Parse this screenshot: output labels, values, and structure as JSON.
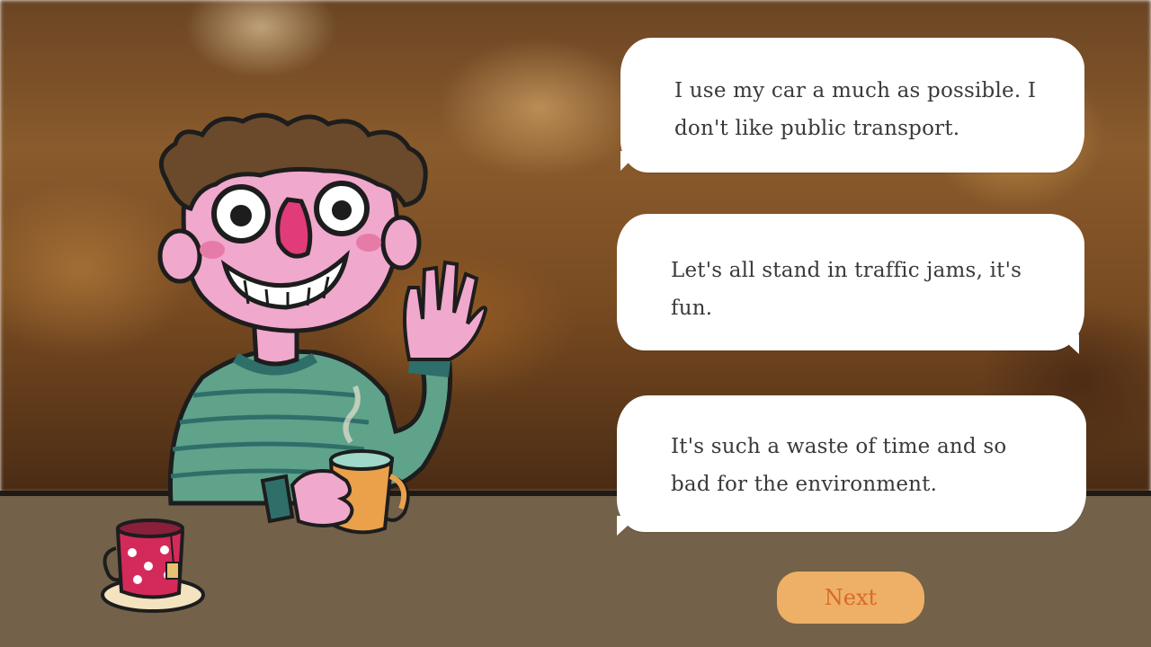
{
  "scene": {
    "background": "blurred-cafe-interior",
    "character": "waving-man-with-mug",
    "props": [
      "tea-cup-on-saucer"
    ]
  },
  "dialogue": {
    "options": [
      {
        "label": "I use my car a much as possible. I don't like public transport."
      },
      {
        "label": "Let's all stand in traffic jams, it's fun."
      },
      {
        "label": "It's such a waste of time and so bad for the environment."
      }
    ]
  },
  "controls": {
    "next_label": "Next"
  },
  "colors": {
    "counter": "#736249",
    "bubble": "#ffffff",
    "next_button": "#eeb066",
    "next_text": "#d86a2a",
    "shirt": "#5fa38a",
    "skin": "#f0a8cc",
    "hair": "#6a4a2a"
  }
}
